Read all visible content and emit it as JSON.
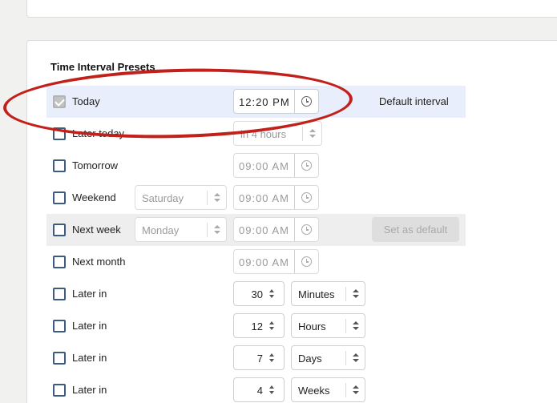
{
  "section_title": "Time Interval Presets",
  "presets": [
    {
      "label": "Today",
      "checked": true,
      "time": "12:20 PM",
      "note": "Default interval"
    },
    {
      "label": "Later today",
      "checked": false,
      "time": "in 4 hours"
    },
    {
      "label": "Tomorrow",
      "checked": false,
      "time": "09:00 AM"
    },
    {
      "label": "Weekend",
      "checked": false,
      "day": "Saturday",
      "time": "09:00 AM"
    },
    {
      "label": "Next week",
      "checked": false,
      "day": "Monday",
      "time": "09:00 AM",
      "action": "Set as default"
    },
    {
      "label": "Next month",
      "checked": false,
      "time": "09:00 AM"
    },
    {
      "label": "Later in",
      "checked": false,
      "amount": "30",
      "unit": "Minutes"
    },
    {
      "label": "Later in",
      "checked": false,
      "amount": "12",
      "unit": "Hours"
    },
    {
      "label": "Later in",
      "checked": false,
      "amount": "7",
      "unit": "Days"
    },
    {
      "label": "Later in",
      "checked": false,
      "amount": "4",
      "unit": "Weeks"
    }
  ],
  "colors": {
    "selected_row": "#e8eefb",
    "checkbox_border": "#3d5a80",
    "annotation": "#c1201b"
  }
}
